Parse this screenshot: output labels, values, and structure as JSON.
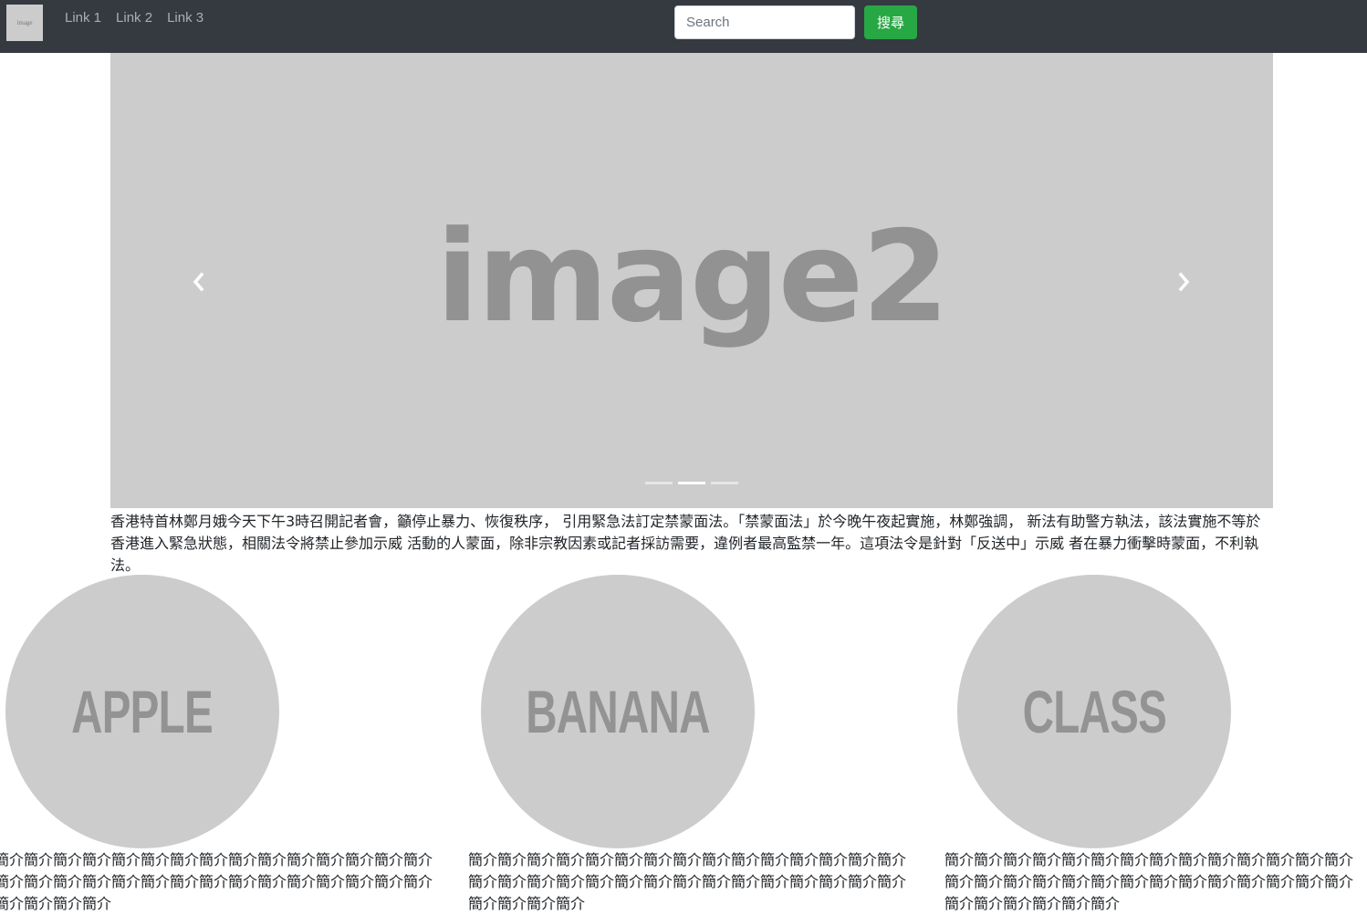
{
  "navbar": {
    "logo_text": "image",
    "links": [
      "Link 1",
      "Link 2",
      "Link 3"
    ],
    "search_placeholder": "Search",
    "search_button": "搜尋"
  },
  "carousel": {
    "slide_text": "image2",
    "indicator_count": 3,
    "active_indicator": 2
  },
  "intro": "香港特首林鄭月娥今天下午3時召開記者會，籲停止暴力、恢復秩序， 引用緊急法訂定禁蒙面法。「禁蒙面法」於今晚午夜起實施，林鄭強調， 新法有助警方執法，該法實施不等於香港進入緊急狀態，相關法令將禁止參加示威 活動的人蒙面，除非宗教因素或記者採訪需要，違例者最高監禁一年。這項法令是針對「反送中」示威 者在暴力衝擊時蒙面，不利執法。",
  "cards": [
    {
      "image_text": "APPLE",
      "description": "簡介簡介簡介簡介簡介簡介簡介簡介簡介簡介簡介簡介簡介簡介簡介簡介簡介簡介簡介簡介簡介簡介簡介簡介簡介簡介簡介簡介簡介簡介簡介簡介簡介簡介"
    },
    {
      "image_text": "BANANA",
      "description": "簡介簡介簡介簡介簡介簡介簡介簡介簡介簡介簡介簡介簡介簡介簡介簡介簡介簡介簡介簡介簡介簡介簡介簡介簡介簡介簡介簡介簡介簡介簡介簡介簡介簡介"
    },
    {
      "image_text": "CLASS",
      "description": "簡介簡介簡介簡介簡介簡介簡介簡介簡介簡介簡介簡介簡介簡介簡介簡介簡介簡介簡介簡介簡介簡介簡介簡介簡介簡介簡介簡介簡介簡介簡介簡介簡介簡介"
    }
  ],
  "colors": {
    "navbar_bg": "#343a40",
    "search_button_bg": "#28a745",
    "placeholder_bg": "#cccccc",
    "placeholder_text": "#929292"
  },
  "icons": {
    "carousel_prev": "chevron-left-icon",
    "carousel_next": "chevron-right-icon"
  }
}
